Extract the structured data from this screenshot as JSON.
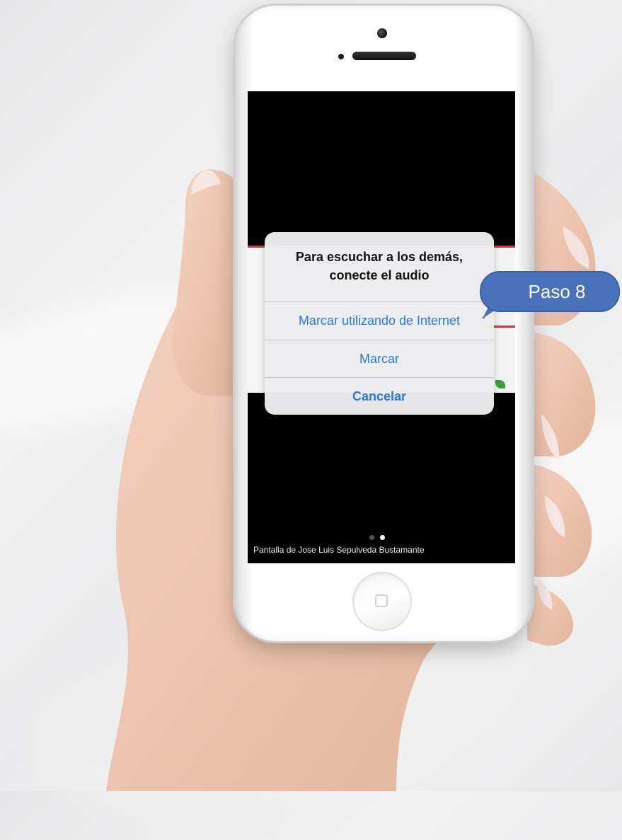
{
  "alert": {
    "title_line1": "Para escuchar a los demás,",
    "title_line2": "conecte el audio",
    "actions": [
      {
        "label": "Marcar utilizando de Internet"
      },
      {
        "label": "Marcar"
      },
      {
        "label": "Cancelar"
      }
    ]
  },
  "screen": {
    "caption": "Pantalla de Jose Luis Sepulveda Bustamante",
    "page_dots": {
      "count": 2,
      "active_index": 1
    }
  },
  "callout": {
    "label": "Paso 8"
  },
  "colors": {
    "accent_blue": "#2b7ad6",
    "callout_blue": "#4a72bb",
    "screen_bg": "#000000"
  }
}
